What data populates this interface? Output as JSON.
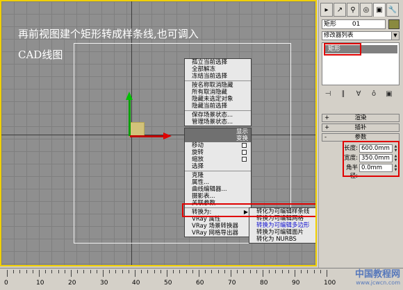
{
  "caption": {
    "line1": "再前视图建个矩形转成样条线,也可调入",
    "line2": "CAD线图"
  },
  "quad_menu_upper": {
    "items": [
      "孤立当前选择",
      "全部解冻",
      "冻结当前选择",
      "按名称取消隐藏",
      "所有取消隐藏",
      "隐藏未选定对象",
      "隐藏当前选择",
      "保存场景状态...",
      "管理场景状态..."
    ],
    "header": "显示"
  },
  "quad_menu_lower": {
    "header": "变换",
    "items": [
      "移动",
      "旋转",
      "缩放",
      "选择",
      "克隆",
      "属性...",
      "曲线编辑器...",
      "摄影表...",
      "关联参数...",
      "转换为:",
      "VRay 属性",
      "VRay 场景转换器",
      "VRay 网格导出器"
    ]
  },
  "convert_submenu": {
    "items": [
      "转化为可编辑样条线",
      "转换为可编辑网格",
      "转换为可编辑多边形",
      "转换为可编辑面片",
      "转化为 NURBS"
    ]
  },
  "panel": {
    "tabs": [
      "▸",
      "↗",
      "⚲",
      "◎",
      "▣",
      "🔧"
    ],
    "object_name": "矩形",
    "object_index": "01",
    "modifier_list": "修改器列表",
    "stack_item": "矩形",
    "rollout_render": "渲染",
    "rollout_interp": "插补",
    "rollout_params": "参数",
    "params": [
      {
        "label": "长度:",
        "value": "600.0mm"
      },
      {
        "label": "宽度:",
        "value": "350.0mm"
      },
      {
        "label": "角半径:",
        "value": "0.0mm"
      }
    ],
    "object_color": "#8a8a40"
  },
  "ruler": {
    "labels": [
      "0",
      "10",
      "20",
      "30",
      "40",
      "50",
      "60",
      "70",
      "80",
      "90",
      "100"
    ]
  },
  "watermark": {
    "line1": "中国教程网",
    "line2": "www.jcwcn.com"
  },
  "colors": {
    "highlight": "#e00000",
    "viewport_border": "#f0d000"
  }
}
